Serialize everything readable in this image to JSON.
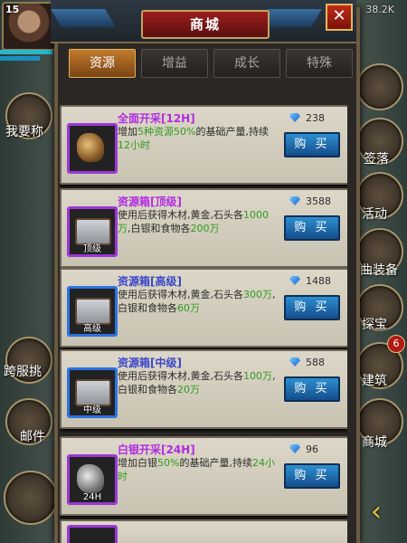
{
  "status": {
    "player_level": "15",
    "resource_readout": "38.2K"
  },
  "sidebar_left": [
    {
      "label": "我要称"
    },
    {
      "label": "跨服挑"
    },
    {
      "label": "邮件"
    }
  ],
  "sidebar_right": [
    {
      "label": "签落"
    },
    {
      "label": "活动"
    },
    {
      "label": "曲装备"
    },
    {
      "label": "探宝"
    },
    {
      "label": "建筑",
      "badge": "6"
    },
    {
      "label": "商城"
    }
  ],
  "shop": {
    "title": "商城",
    "close_icon": "close-icon",
    "tabs": [
      {
        "label": "资源",
        "active": true
      },
      {
        "label": "增益",
        "active": false
      },
      {
        "label": "成长",
        "active": false
      },
      {
        "label": "特殊",
        "active": false
      }
    ],
    "items": [
      {
        "name": "全面开采[12H]",
        "desc_a": "增加",
        "desc_b": "5种资源50%",
        "desc_c": "的基础产量,持续",
        "desc_d": "12小时",
        "price": "238",
        "buy": "购 买",
        "icon_tag": "",
        "icon": "mining-icon"
      },
      {
        "name": "资源箱[顶级]",
        "desc_a": "使用后获得木材,黄金,石头各",
        "desc_b": "1000万",
        "desc_c": ",白银和食物各",
        "desc_d": "200万",
        "price": "3588",
        "buy": "购 买",
        "icon_tag": "顶级",
        "icon": "chest-icon"
      },
      {
        "name": "资源箱[高级]",
        "desc_a": "使用后获得木材,黄金,石头各",
        "desc_b": "300万",
        "desc_c": ",白银和食物各",
        "desc_d": "60万",
        "price": "1488",
        "buy": "购 买",
        "icon_tag": "高级",
        "icon": "chest-icon"
      },
      {
        "name": "资源箱[中级]",
        "desc_a": "使用后获得木材,黄金,石头各",
        "desc_b": "100万",
        "desc_c": ",白银和食物各",
        "desc_d": "20万",
        "price": "588",
        "buy": "购 买",
        "icon_tag": "中级",
        "icon": "chest-icon"
      },
      {
        "name": "白银开采[24H]",
        "desc_a": "增加白银",
        "desc_b": "50%",
        "desc_c": "的基础产量,持续",
        "desc_d": "24小时",
        "price": "96",
        "buy": "购 买",
        "icon_tag": "24H",
        "icon": "silver-ore-icon"
      }
    ]
  }
}
